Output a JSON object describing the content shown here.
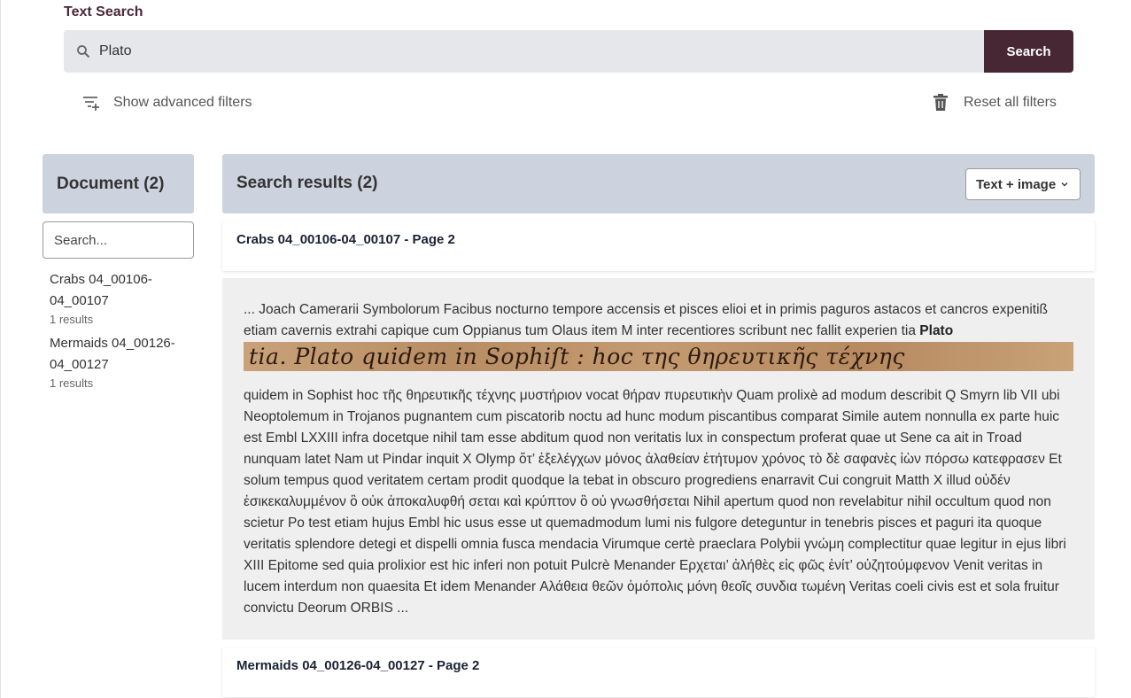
{
  "search": {
    "section_label": "Text Search",
    "query": "Plato",
    "button_label": "Search",
    "advanced_label": "Show advanced filters",
    "reset_label": "Reset all filters"
  },
  "facet": {
    "title": "Document (2)",
    "search_placeholder": "Search...",
    "items": [
      {
        "name": "Crabs 04_00106-04_00107",
        "count": "1 results"
      },
      {
        "name": "Mermaids 04_00126-04_00127",
        "count": "1 results"
      }
    ]
  },
  "results": {
    "title": "Search results (2)",
    "view_mode": "Text + image",
    "items": [
      {
        "title": "Crabs 04_00106-04_00107 - Page 2",
        "before_text": "... Joach Camerarii Symbolorum Facibus nocturno tempore accensis et pisces elioi et in primis paguros astacos et cancros expenitiß etiam cavernis extrahi capique cum Oppianus tum Olaus item M inter recentiores scribunt nec fallit experien tia ",
        "highlight": "Plato",
        "image_text": "tia. Plato quidem in Sophiſt : hoc της θηρευτικῆς τέχνης",
        "after_text": " quidem in Sophist hoc τῆς θηρευτικῆς τέχνης μυστήριον vocat θήραν πυρευτικὴν Quam prolixè ad modum describit Q Smyrn lib VII ubi Neoptolemum in Trojanos pugnantem cum piscatorib noctu ad hunc modum piscantibus comparat Simile autem nonnulla ex parte huic est Embl LXXIII infra docetque nihil tam esse abditum quod non veritatis lux in conspectum proferat quae ut Sene ca ait in Troad nunquam latet Nam ut Pindar inquit X Olymp ὅτ’ ἐξελέγχων μόνος ἀλαθείαν ἐτήτυμον χρόνος τὸ δὲ σαφανὲς ἰὼν πόρσω κατεφρασεν Et solum tempus quod veritatem certam prodit quodque la tebat in obscuro progrediens enarravit Cui congruit Matth X illud οὐδέν ἐσικεκαλυμμένον ὃ οὐκ ἀποκαλυφθή σεται καὶ κρύπτον ὃ οὐ γνωσθήσεται Nihil apertum quod non revelabitur nihil occultum quod non scietur Po test etiam hujus Embl hic usus esse ut quemadmodum lumi nis fulgore deteguntur in tenebris pisces et paguri ita quoque veritatis splendore detegi et dispelli omnia fusca mendacia Virumque certè praeclara Polybii γνώμη complectitur quae legitur in ejus libri XIII Epitome sed quia prolixior est hic inferi non potuit Pulcrè Menander Ερχεται’ ἀλήθὲς εἰς φῶς ἐνίτ’ οὐζητούμφενον Venit veritas in lucem interdum non quaesita Et idem Menander Αλάθεια θεῶν ὁμόπολις μόνη θεοῖς συνδια τωμένη Veritas coeli civis est et sola fruitur convictu Deorum ORBIS   ..."
      },
      {
        "title": "Mermaids 04_00126-04_00127 - Page 2"
      }
    ]
  },
  "colors": {
    "accent": "#472734",
    "panel": "#cdd3de",
    "input_bg": "#e5e7eb",
    "snippet_bg": "#efefef"
  },
  "icons": [
    "search-icon",
    "filter-add-icon",
    "trash-icon",
    "chevron-down-icon"
  ]
}
